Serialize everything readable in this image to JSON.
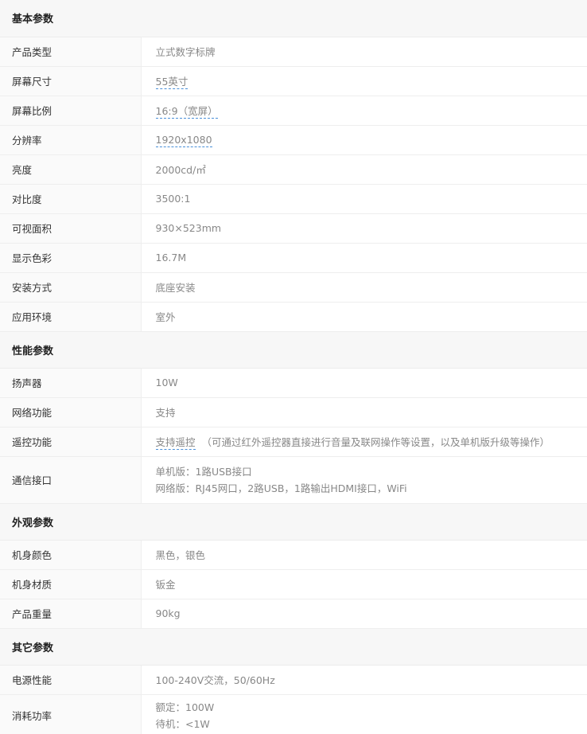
{
  "sections": [
    {
      "title": "基本参数",
      "rows": [
        {
          "label": "产品类型",
          "value": "立式数字标牌"
        },
        {
          "label": "屏幕尺寸",
          "value": "55英寸"
        },
        {
          "label": "屏幕比例",
          "value": "16:9（宽屏）"
        },
        {
          "label": "分辨率",
          "value": "1920x1080"
        },
        {
          "label": "亮度",
          "value": "2000cd/㎡"
        },
        {
          "label": "对比度",
          "value": "3500:1"
        },
        {
          "label": "可视面积",
          "value": "930×523mm"
        },
        {
          "label": "显示色彩",
          "value": "16.7M"
        },
        {
          "label": "安装方式",
          "value": "底座安装"
        },
        {
          "label": "应用环境",
          "value": "室外"
        }
      ]
    },
    {
      "title": "性能参数",
      "rows": [
        {
          "label": "扬声器",
          "value": "10W"
        },
        {
          "label": "网络功能",
          "value": "支持"
        },
        {
          "label": "遥控功能",
          "value": "支持遥控",
          "note": "（可通过红外遥控器直接进行音量及联网操作等设置，以及单机版升级等操作）"
        },
        {
          "label": "通信接口",
          "lines": [
            "单机版：1路USB接口",
            "网络版：RJ45网口，2路USB，1路输出HDMI接口，WiFi"
          ]
        }
      ]
    },
    {
      "title": "外观参数",
      "rows": [
        {
          "label": "机身颜色",
          "value": "黑色，银色"
        },
        {
          "label": "机身材质",
          "value": "钣金"
        },
        {
          "label": "产品重量",
          "value": "90kg"
        }
      ]
    },
    {
      "title": "其它参数",
      "rows": [
        {
          "label": "电源性能",
          "value": "100-240V交流，50/60Hz"
        },
        {
          "label": "消耗功率",
          "lines": [
            "额定：100W",
            "待机：<1W"
          ]
        }
      ]
    }
  ]
}
